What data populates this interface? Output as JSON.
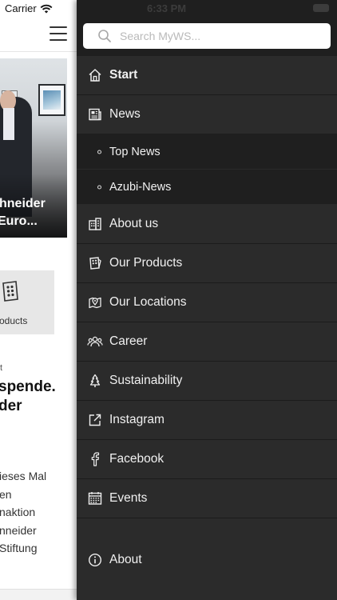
{
  "status_bar": {
    "carrier": "Carrier",
    "time": "6:33 PM"
  },
  "background": {
    "hero_title_line1": "hneider",
    "hero_title_line2": "Euro...",
    "products_label": "oducts",
    "article_tiny": "t",
    "article_headline_line1": "spende.",
    "article_headline_line2": " der",
    "article_body": [
      "ieses Mal",
      "en",
      "naktion",
      "nneider",
      " Stiftung"
    ]
  },
  "search": {
    "placeholder": "Search MyWS..."
  },
  "menu": {
    "items": [
      {
        "label": "Start",
        "icon": "home-icon",
        "active": true
      },
      {
        "label": "News",
        "icon": "newspaper-icon"
      },
      {
        "label": "Top News",
        "icon": "bullet-icon",
        "sub": true
      },
      {
        "label": "Azubi-News",
        "icon": "bullet-icon",
        "sub": true
      },
      {
        "label": "About us",
        "icon": "building-icon"
      },
      {
        "label": "Our Products",
        "icon": "products-icon"
      },
      {
        "label": "Our Locations",
        "icon": "map-pin-icon"
      },
      {
        "label": "Career",
        "icon": "people-icon"
      },
      {
        "label": "Sustainability",
        "icon": "tree-icon"
      },
      {
        "label": "Instagram",
        "icon": "external-link-icon"
      },
      {
        "label": "Facebook",
        "icon": "facebook-icon"
      },
      {
        "label": "Events",
        "icon": "calendar-icon"
      }
    ],
    "about": {
      "label": "About",
      "icon": "info-icon"
    }
  },
  "colors": {
    "drawer_bg": "#2b2b2b",
    "drawer_header_bg": "#1f1f1f",
    "submenu_bg": "#1f1f1f",
    "text": "#f1f1f1"
  }
}
